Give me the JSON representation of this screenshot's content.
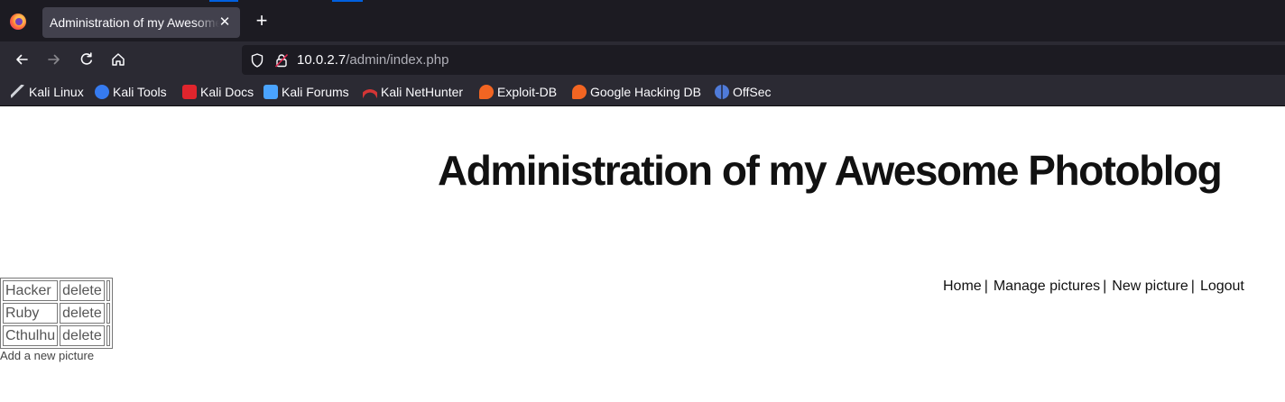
{
  "browser": {
    "tab": {
      "title": "Administration of my Awesome Photoblog",
      "close_icon": "close-icon"
    },
    "new_tab_icon": "plus-icon",
    "url": {
      "host": "10.0.2.7",
      "path": "/admin/index.php"
    },
    "bookmarks": [
      {
        "label": "Kali Linux",
        "icon": "kali-dragon-icon",
        "color": "#cfd2d8"
      },
      {
        "label": "Kali Tools",
        "icon": "kali-tools-icon",
        "color": "#367bf0"
      },
      {
        "label": "Kali Docs",
        "icon": "kali-docs-icon",
        "color": "#e0252d"
      },
      {
        "label": "Kali Forums",
        "icon": "kali-forums-icon",
        "color": "#4aa4ff"
      },
      {
        "label": "Kali NetHunter",
        "icon": "nethunter-icon",
        "color": "#d43535"
      },
      {
        "label": "Exploit-DB",
        "icon": "exploit-db-icon",
        "color": "#f26522"
      },
      {
        "label": "Google Hacking DB",
        "icon": "ghdb-icon",
        "color": "#f26522"
      },
      {
        "label": "OffSec",
        "icon": "offsec-icon",
        "color": "#4f7bd9"
      }
    ]
  },
  "page": {
    "title": "Administration of my Awesome Photoblog",
    "menu": [
      {
        "label": "Home"
      },
      {
        "label": "Manage pictures"
      },
      {
        "label": "New picture"
      },
      {
        "label": "Logout"
      }
    ],
    "menu_separator": "|",
    "pictures": [
      {
        "name": "Hacker",
        "action": "delete"
      },
      {
        "name": "Ruby",
        "action": "delete"
      },
      {
        "name": "Cthulhu",
        "action": "delete"
      }
    ],
    "add_link": "Add a new picture"
  }
}
